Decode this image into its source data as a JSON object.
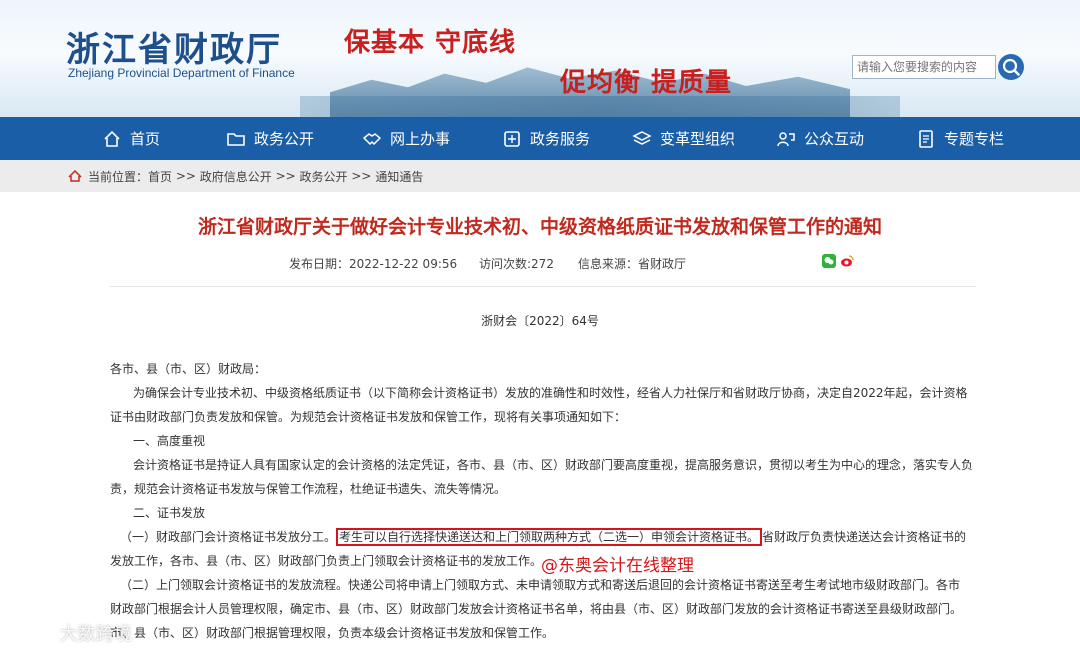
{
  "header": {
    "logo_cn": "浙江省财政厅",
    "logo_en": "Zhejiang Provincial Department of Finance",
    "slogan_1": "保基本  守底线",
    "slogan_2": "促均衡  提质量",
    "search_placeholder": "请输入您要搜索的内容"
  },
  "nav": {
    "items": [
      {
        "label": "首页",
        "icon": "home-icon"
      },
      {
        "label": "政务公开",
        "icon": "folder-icon"
      },
      {
        "label": "网上办事",
        "icon": "handshake-icon"
      },
      {
        "label": "政务服务",
        "icon": "service-icon"
      },
      {
        "label": "变革型组织",
        "icon": "layers-icon"
      },
      {
        "label": "公众互动",
        "icon": "interaction-icon"
      },
      {
        "label": "专题专栏",
        "icon": "document-icon"
      }
    ]
  },
  "breadcrumb": {
    "prefix": "当前位置：",
    "items": [
      "首页",
      "政府信息公开",
      "政务公开",
      "通知通告"
    ],
    "sep": " >> "
  },
  "article": {
    "title": "浙江省财政厅关于做好会计专业技术初、中级资格纸质证书发放和保管工作的通知",
    "publish_date": "发布日期：2022-12-22 09:56",
    "visits": "访问次数:272",
    "source": "信息来源：省财政厅",
    "doc_no": "浙财会〔2022〕64号",
    "addressee": "各市、县（市、区）财政局：",
    "p1_line1": "为确保会计专业技术初、中级资格纸质证书（以下简称会计资格证书）发放的准确性和时效性，经省人力社保厅和省财政厅协商，决定自2022年起，会计资格",
    "p1_line2": "证书由财政部门负责发放和保管。为规范会计资格证书发放和保管工作，现将有关事项通知如下：",
    "h1": "一、高度重视",
    "p2_line1": "会计资格证书是持证人具有国家认定的会计资格的法定凭证，各市、县（市、区）财政部门要高度重视，提高服务意识，贯彻以考生为中心的理念，落实专人负",
    "p2_line2": "责，规范会计资格证书发放与保管工作流程，杜绝证书遗失、流失等情况。",
    "h2": "二、证书发放",
    "p3_pre": "（一）财政部门会计资格证书发放分工。",
    "p3_highlight": "考生可以自行选择快递送达和上门领取两种方式（二选一）申领会计资格证书。",
    "p3_post": "省财政厅负责快递送达会计资格证书的",
    "p3_line2": "发放工作，各市、县（市、区）财政部门负责上门领取会计资格证书的发放工作。",
    "p4_line1": "（二）上门领取会计资格证书的发放流程。快递公司将申请上门领取方式、未申请领取方式和寄送后退回的会计资格证书寄送至考生考试地市级财政部门。各市",
    "p4_line2": "财政部门根据会计人员管理权限，确定市、县（市、区）财政部门发放会计资格证书名单，将由县（市、区）财政部门发放的会计资格证书寄送至县级财政部门。",
    "p4_line3": "市、县（市、区）财政部门根据管理权限，负责本级会计资格证书发放和保管工作。"
  },
  "annotation": "@东奥会计在线整理",
  "watermark": "大数跨境",
  "colors": {
    "nav": "#1a5ea8",
    "title": "#c0291e",
    "highlight": "#d6141b"
  }
}
